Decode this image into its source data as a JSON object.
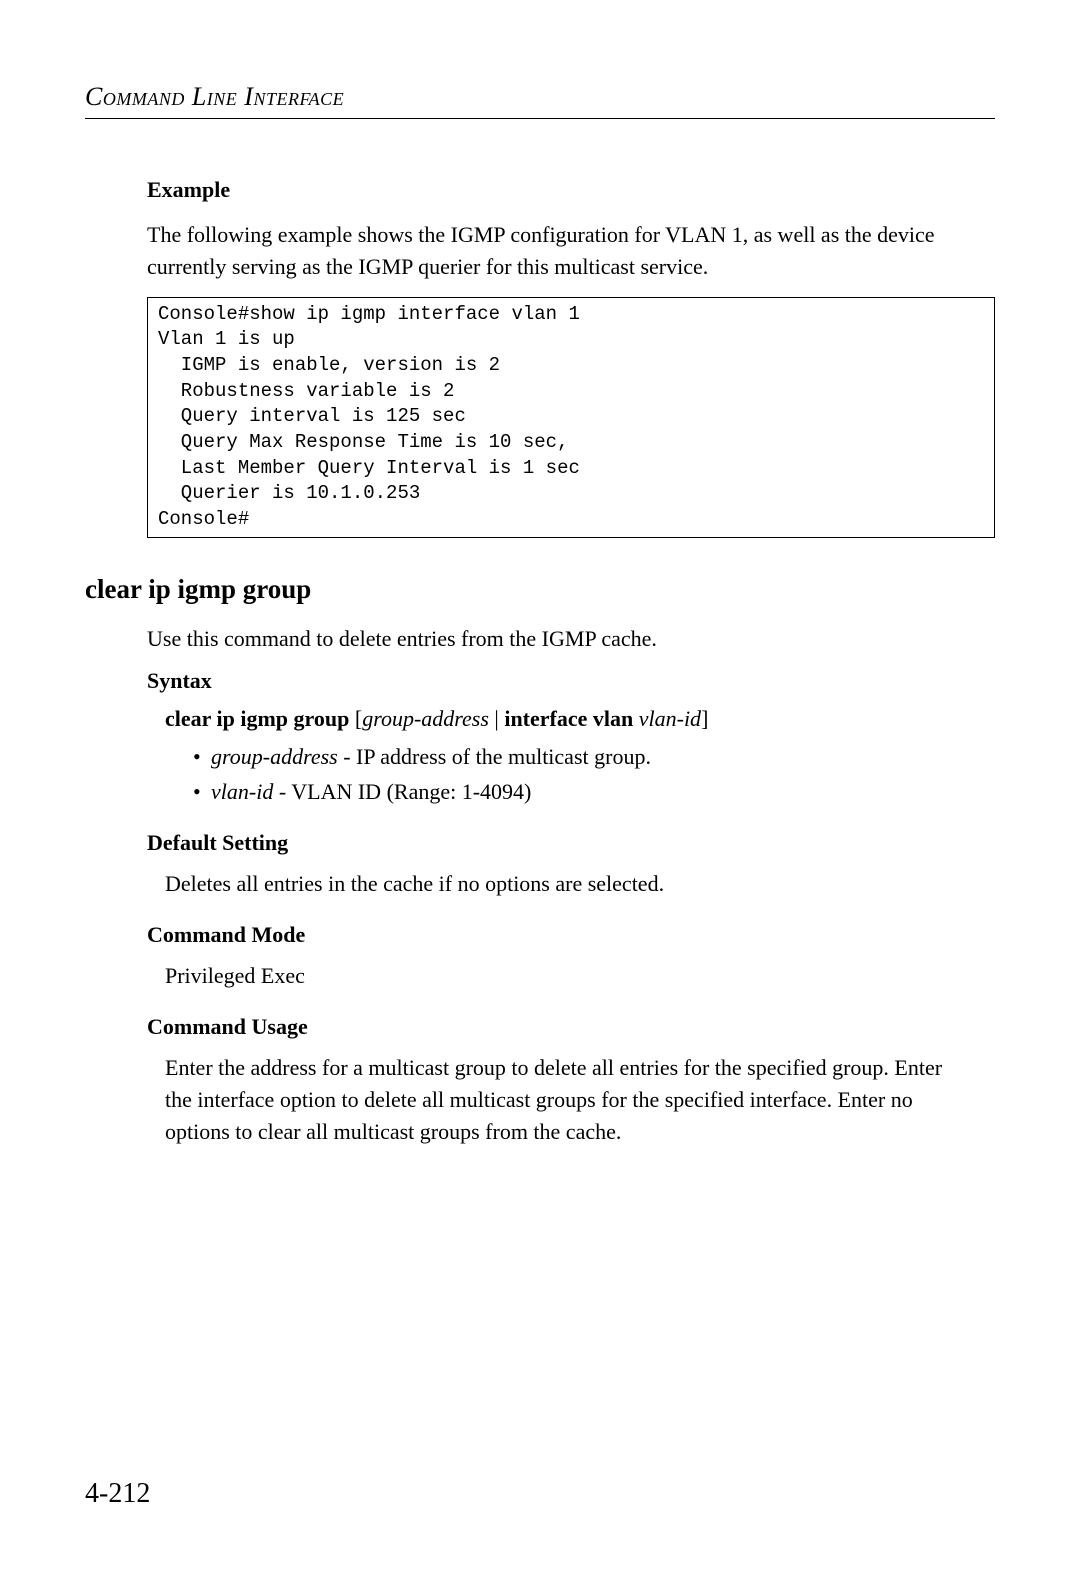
{
  "header": "Command Line Interface",
  "example": {
    "heading": "Example",
    "description": "The following example shows the IGMP configuration for VLAN 1, as well as the device currently serving as the IGMP querier for this multicast service.",
    "code": "Console#show ip igmp interface vlan 1\nVlan 1 is up\n  IGMP is enable, version is 2\n  Robustness variable is 2\n  Query interval is 125 sec\n  Query Max Response Time is 10 sec,\n  Last Member Query Interval is 1 sec\n  Querier is 10.1.0.253\nConsole#"
  },
  "command": {
    "title": "clear ip igmp group",
    "description": "Use this command to delete entries from the IGMP cache.",
    "syntax": {
      "heading": "Syntax",
      "prefix": "clear ip igmp group",
      "bracket_open": " [",
      "arg1": "group-address",
      "pipe": " | ",
      "bold2": "interface vlan ",
      "arg2": "vlan-id",
      "bracket_close": "]",
      "bullets": [
        {
          "term": "group-address",
          "desc": " - IP address of the multicast group."
        },
        {
          "term": "vlan-id",
          "desc": " - VLAN ID (Range: 1-4094)"
        }
      ]
    },
    "default_setting": {
      "heading": "Default Setting",
      "text": "Deletes all entries in the cache if no options are selected."
    },
    "command_mode": {
      "heading": "Command Mode",
      "text": "Privileged Exec"
    },
    "command_usage": {
      "heading": "Command Usage",
      "text": "Enter the address for a multicast group to delete all entries for the specified group. Enter the interface option to delete all multicast groups for the specified interface. Enter no options to clear all multicast groups from the cache."
    }
  },
  "page_number": "4-212"
}
